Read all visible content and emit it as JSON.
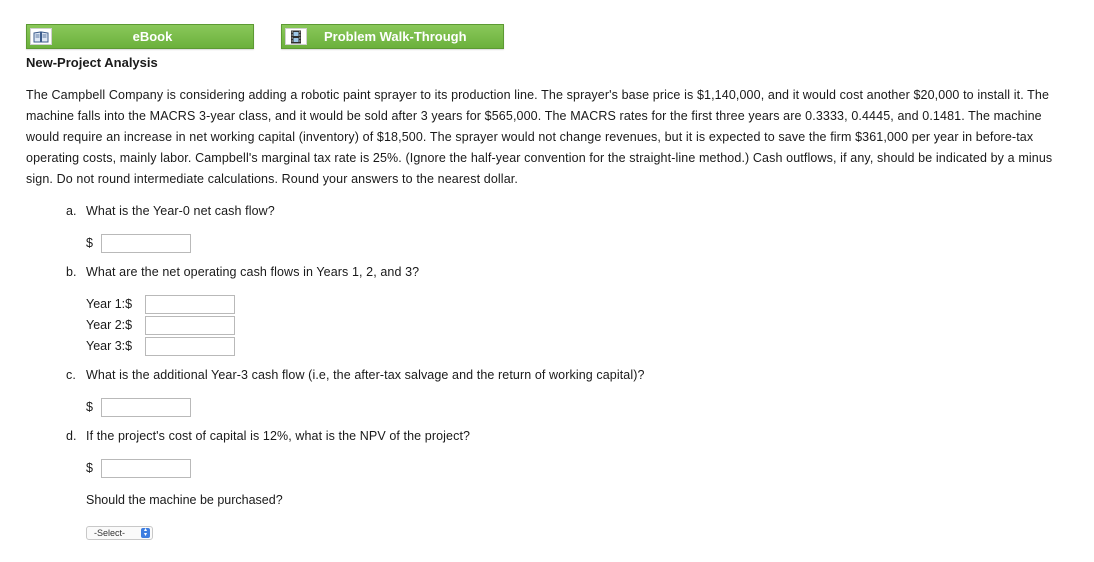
{
  "buttons": {
    "ebook": "eBook",
    "walkthrough": "Problem Walk-Through"
  },
  "title": "New-Project Analysis",
  "problem_text": "The Campbell Company is considering adding a robotic paint sprayer to its production line. The sprayer's base price is $1,140,000, and it would cost another $20,000 to install it. The machine falls into the MACRS 3-year class, and it would be sold after 3 years for $565,000. The MACRS rates for the first three years are 0.3333, 0.4445, and 0.1481. The machine would require an increase in net working capital (inventory) of $18,500. The sprayer would not change revenues, but it is expected to save the firm $361,000 per year in before-tax operating costs, mainly labor. Campbell's marginal tax rate is 25%. (Ignore the half-year convention for the straight-line method.) Cash outflows, if any, should be indicated by a minus sign. Do not round intermediate calculations. Round your answers to the nearest dollar.",
  "questions": {
    "a": {
      "letter": "a.",
      "text": "What is the Year-0 net cash flow?",
      "currency": "$"
    },
    "b": {
      "letter": "b.",
      "text": "What are the net operating cash flows in Years 1, 2, and 3?",
      "years": [
        "Year 1:$",
        "Year 2:$",
        "Year 3:$"
      ]
    },
    "c": {
      "letter": "c.",
      "text": "What is the additional Year-3 cash flow (i.e, the after-tax salvage and the return of working capital)?",
      "currency": "$"
    },
    "d": {
      "letter": "d.",
      "text": "If the project's cost of capital is 12%, what is the NPV of the project?",
      "currency": "$",
      "purchase_question": "Should the machine be purchased?",
      "select_value": "-Select-"
    }
  },
  "colors": {
    "button_green": "#74b843",
    "select_arrow": "#3d7de0"
  },
  "icons": {
    "ebook": "open-book-icon",
    "walkthrough": "film-strip-icon"
  }
}
